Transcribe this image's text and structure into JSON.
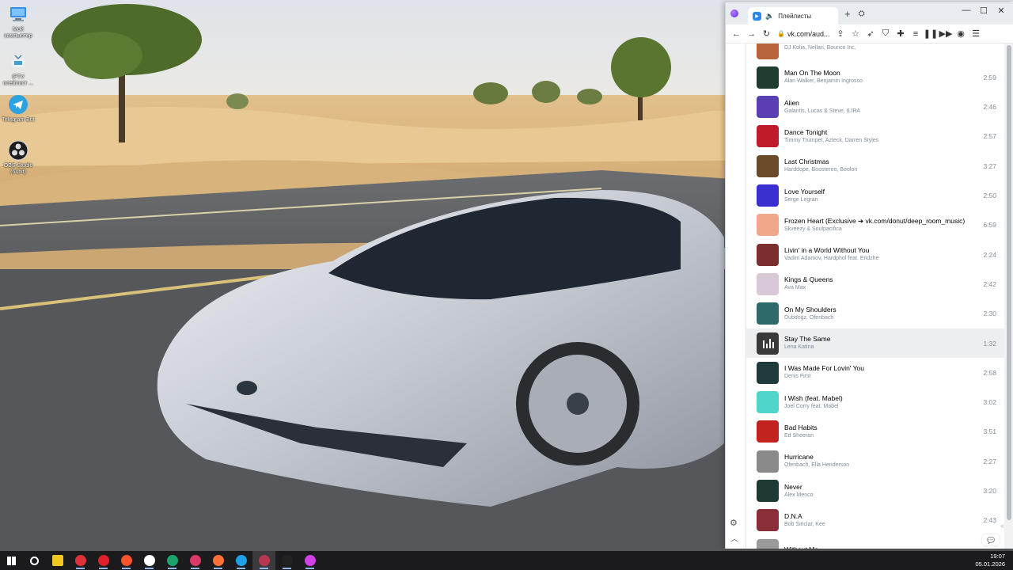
{
  "desktop": {
    "icons": [
      {
        "label": "Мой компьютер",
        "icon": "computer-icon"
      },
      {
        "label": "IPTV плейлист ...",
        "icon": "iptv-icon"
      },
      {
        "label": "Telegram Bot",
        "icon": "telegram-icon"
      },
      {
        "label": "OBS Studio (64bit)",
        "icon": "obs-icon"
      }
    ]
  },
  "browser": {
    "tab_title": "Плейлисты",
    "url": "vk.com/aud...",
    "tracks": [
      {
        "title": "",
        "artist": "DJ Kolia, Nellari, Bounce Inc.",
        "duration": "",
        "color": "#b8633a"
      },
      {
        "title": "Man On The Moon",
        "artist": "Alan Walker, Benjamin Ingrosso",
        "duration": "2:59",
        "color": "#1f3d2f"
      },
      {
        "title": "Alien",
        "artist": "Galantis, Lucas & Steve, ILIRA",
        "duration": "2:46",
        "color": "#5a3fb3"
      },
      {
        "title": "Dance Tonight",
        "artist": "Timmy Trumpet, Azteck, Darren Styles",
        "duration": "2:57",
        "color": "#c01b2a"
      },
      {
        "title": "Last Christmas",
        "artist": "Harddope, Boostereo, Beolon",
        "duration": "3:27",
        "color": "#6b4a2a"
      },
      {
        "title": "Love Yourself",
        "artist": "Serge Legran",
        "duration": "2:50",
        "color": "#3a2fd0"
      },
      {
        "title": "Frozen Heart (Exclusive ➔ vk.com/donut/deep_room_music)",
        "artist": "Skveezy & Soulpacifica",
        "duration": "6:59",
        "color": "#f0a88a"
      },
      {
        "title": "Livin' in a World Without You",
        "artist": "Vadim Adamov, Hardphol feat. Endzhe",
        "duration": "2:24",
        "color": "#7a2e2e"
      },
      {
        "title": "Kings & Queens",
        "artist": "Ava Max",
        "duration": "2:42",
        "color": "#d9c9d6"
      },
      {
        "title": "On My Shoulders",
        "artist": "Dubdogz, Ofenbach",
        "duration": "2:30",
        "color": "#2f6a6a"
      },
      {
        "title": "Stay The Same",
        "artist": "Lena Katina",
        "duration": "1:32",
        "color": "#3a3a3a"
      },
      {
        "title": "I Was Made For Lovin' You",
        "artist": "Denis First",
        "duration": "2:58",
        "color": "#1e3a3a"
      },
      {
        "title": "I Wish (feat. Mabel)",
        "artist": "Joel Corry feat. Mabel",
        "duration": "3:02",
        "color": "#4fd6c8"
      },
      {
        "title": "Bad Habits",
        "artist": "Ed Sheeran",
        "duration": "3:51",
        "color": "#c3231f"
      },
      {
        "title": "Hurricane",
        "artist": "Ofenbach, Ella Henderson",
        "duration": "2:27",
        "color": "#8a8a8a"
      },
      {
        "title": "Never",
        "artist": "Alex Menco",
        "duration": "3:20",
        "color": "#1d3a34"
      },
      {
        "title": "D.N.A",
        "artist": "Bob Sinclar, Kee",
        "duration": "2:43",
        "color": "#8a2f3a"
      },
      {
        "title": "Without Me",
        "artist": "",
        "duration": "",
        "color": "#9a9a9a"
      }
    ],
    "playing_index": 10
  },
  "taskbar": {
    "time": "19:07",
    "date": "05.01.2026",
    "apps": [
      {
        "icon": "windows-start-icon",
        "color": "#ffffff"
      },
      {
        "icon": "search-icon",
        "color": "#ffffff"
      },
      {
        "icon": "file-explorer-icon",
        "color": "#f3c623"
      },
      {
        "icon": "vivaldi-icon",
        "color": "#e0313a"
      },
      {
        "icon": "opera-icon",
        "color": "#e01f2b"
      },
      {
        "icon": "brave-icon",
        "color": "#fb542b"
      },
      {
        "icon": "yandex-browser-icon",
        "color": "#ffffff"
      },
      {
        "icon": "chromium-icon",
        "color": "#1aa36a"
      },
      {
        "icon": "browser-icon",
        "color": "#d93b66"
      },
      {
        "icon": "firefox-icon",
        "color": "#ff7139"
      },
      {
        "icon": "edge-icon",
        "color": "#1fa0e6"
      },
      {
        "icon": "active-browser-icon",
        "color": "#b8354f"
      },
      {
        "icon": "obs-icon",
        "color": "#222222"
      },
      {
        "icon": "app-icon",
        "color": "#d13fe6"
      }
    ]
  }
}
